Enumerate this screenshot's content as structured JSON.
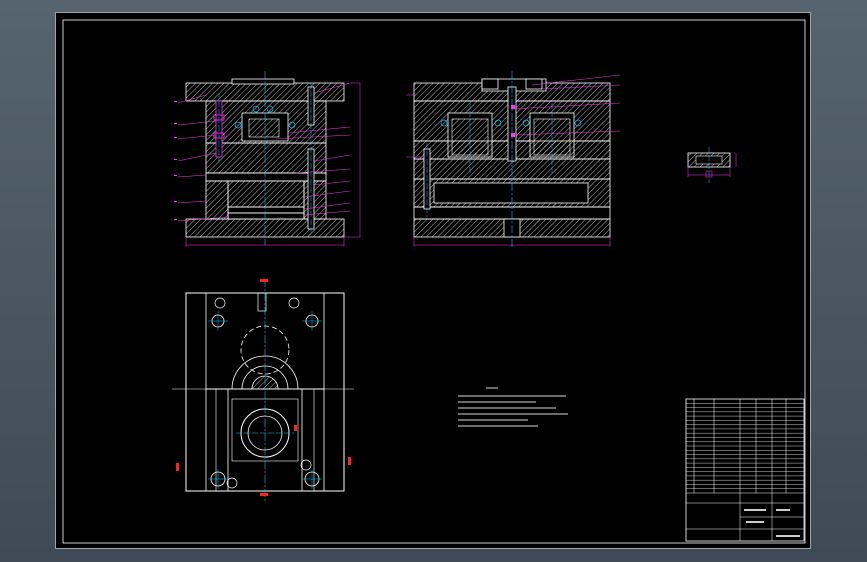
{
  "drawing": {
    "scheme_label": "",
    "section_label": "",
    "section_small_label": "",
    "notes_title": "",
    "notes": [
      "",
      "",
      "",
      "",
      "",
      ""
    ],
    "title_block": {
      "drawing_title": "",
      "scale_label": "",
      "company": "",
      "part_rows": 22
    }
  },
  "colors": {
    "background": "#000000",
    "outline": "#ffffff",
    "centerline": "#00c8ff",
    "dimension": "#ff33ff",
    "hatch": "#ffffff",
    "mark": "#ff2020",
    "frame": "#55626d"
  }
}
